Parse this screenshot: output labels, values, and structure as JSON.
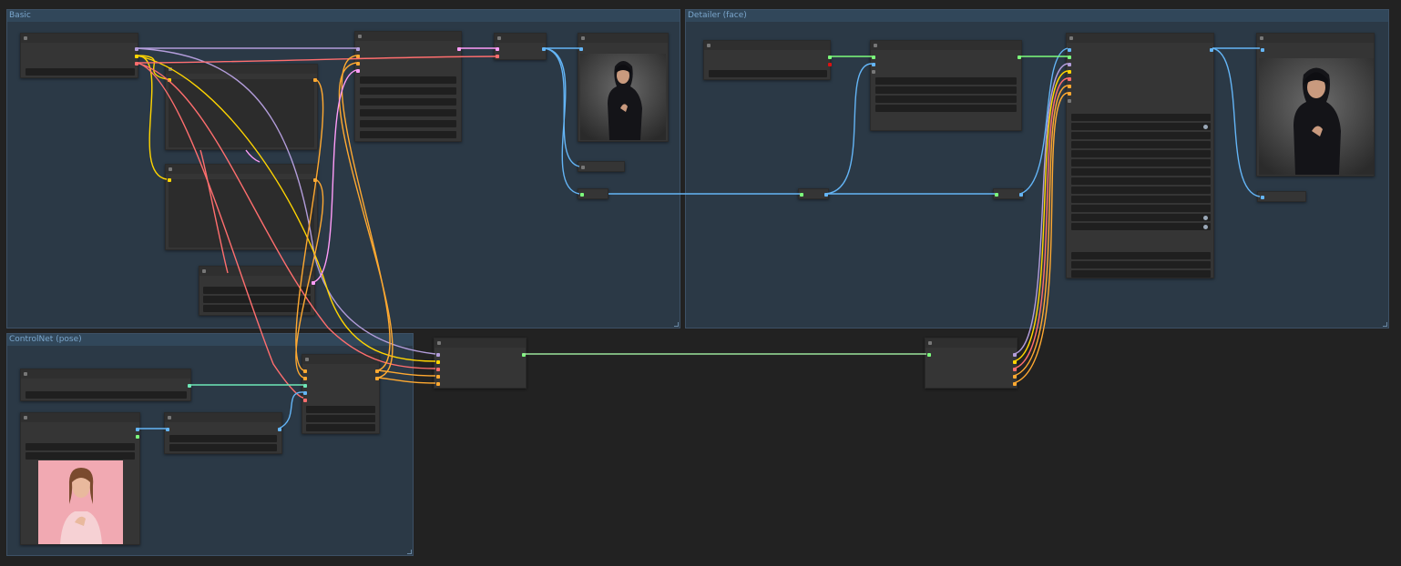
{
  "groups": {
    "basic": {
      "title": "Basic"
    },
    "detailer": {
      "title": "Detailer (face)"
    },
    "controlnet": {
      "title": "ControlNet (pose)"
    }
  },
  "colors": {
    "canvas": "#222222",
    "group_fill": "#2b3946",
    "group_title": "#7aa6cc",
    "link_model": "#b39ddb",
    "link_clip": "#ffd500",
    "link_vae": "#ff6e6e",
    "link_conditioning": "#ffa931",
    "link_latent": "#ff9cf9",
    "link_image": "#64b5f6",
    "link_controlnet": "#6ee7b7",
    "link_detector": "#7cfc7c"
  },
  "icons": {
    "node_collapse": "node-collapse-dot-icon",
    "group_resize": "resize-corner-icon"
  },
  "previews": {
    "basic_output": "woman-in-black-hijab-preview",
    "detailer_output": "woman-in-black-hijab-detailed-preview",
    "pose_input": "woman-in-pink-top-pose-reference"
  }
}
